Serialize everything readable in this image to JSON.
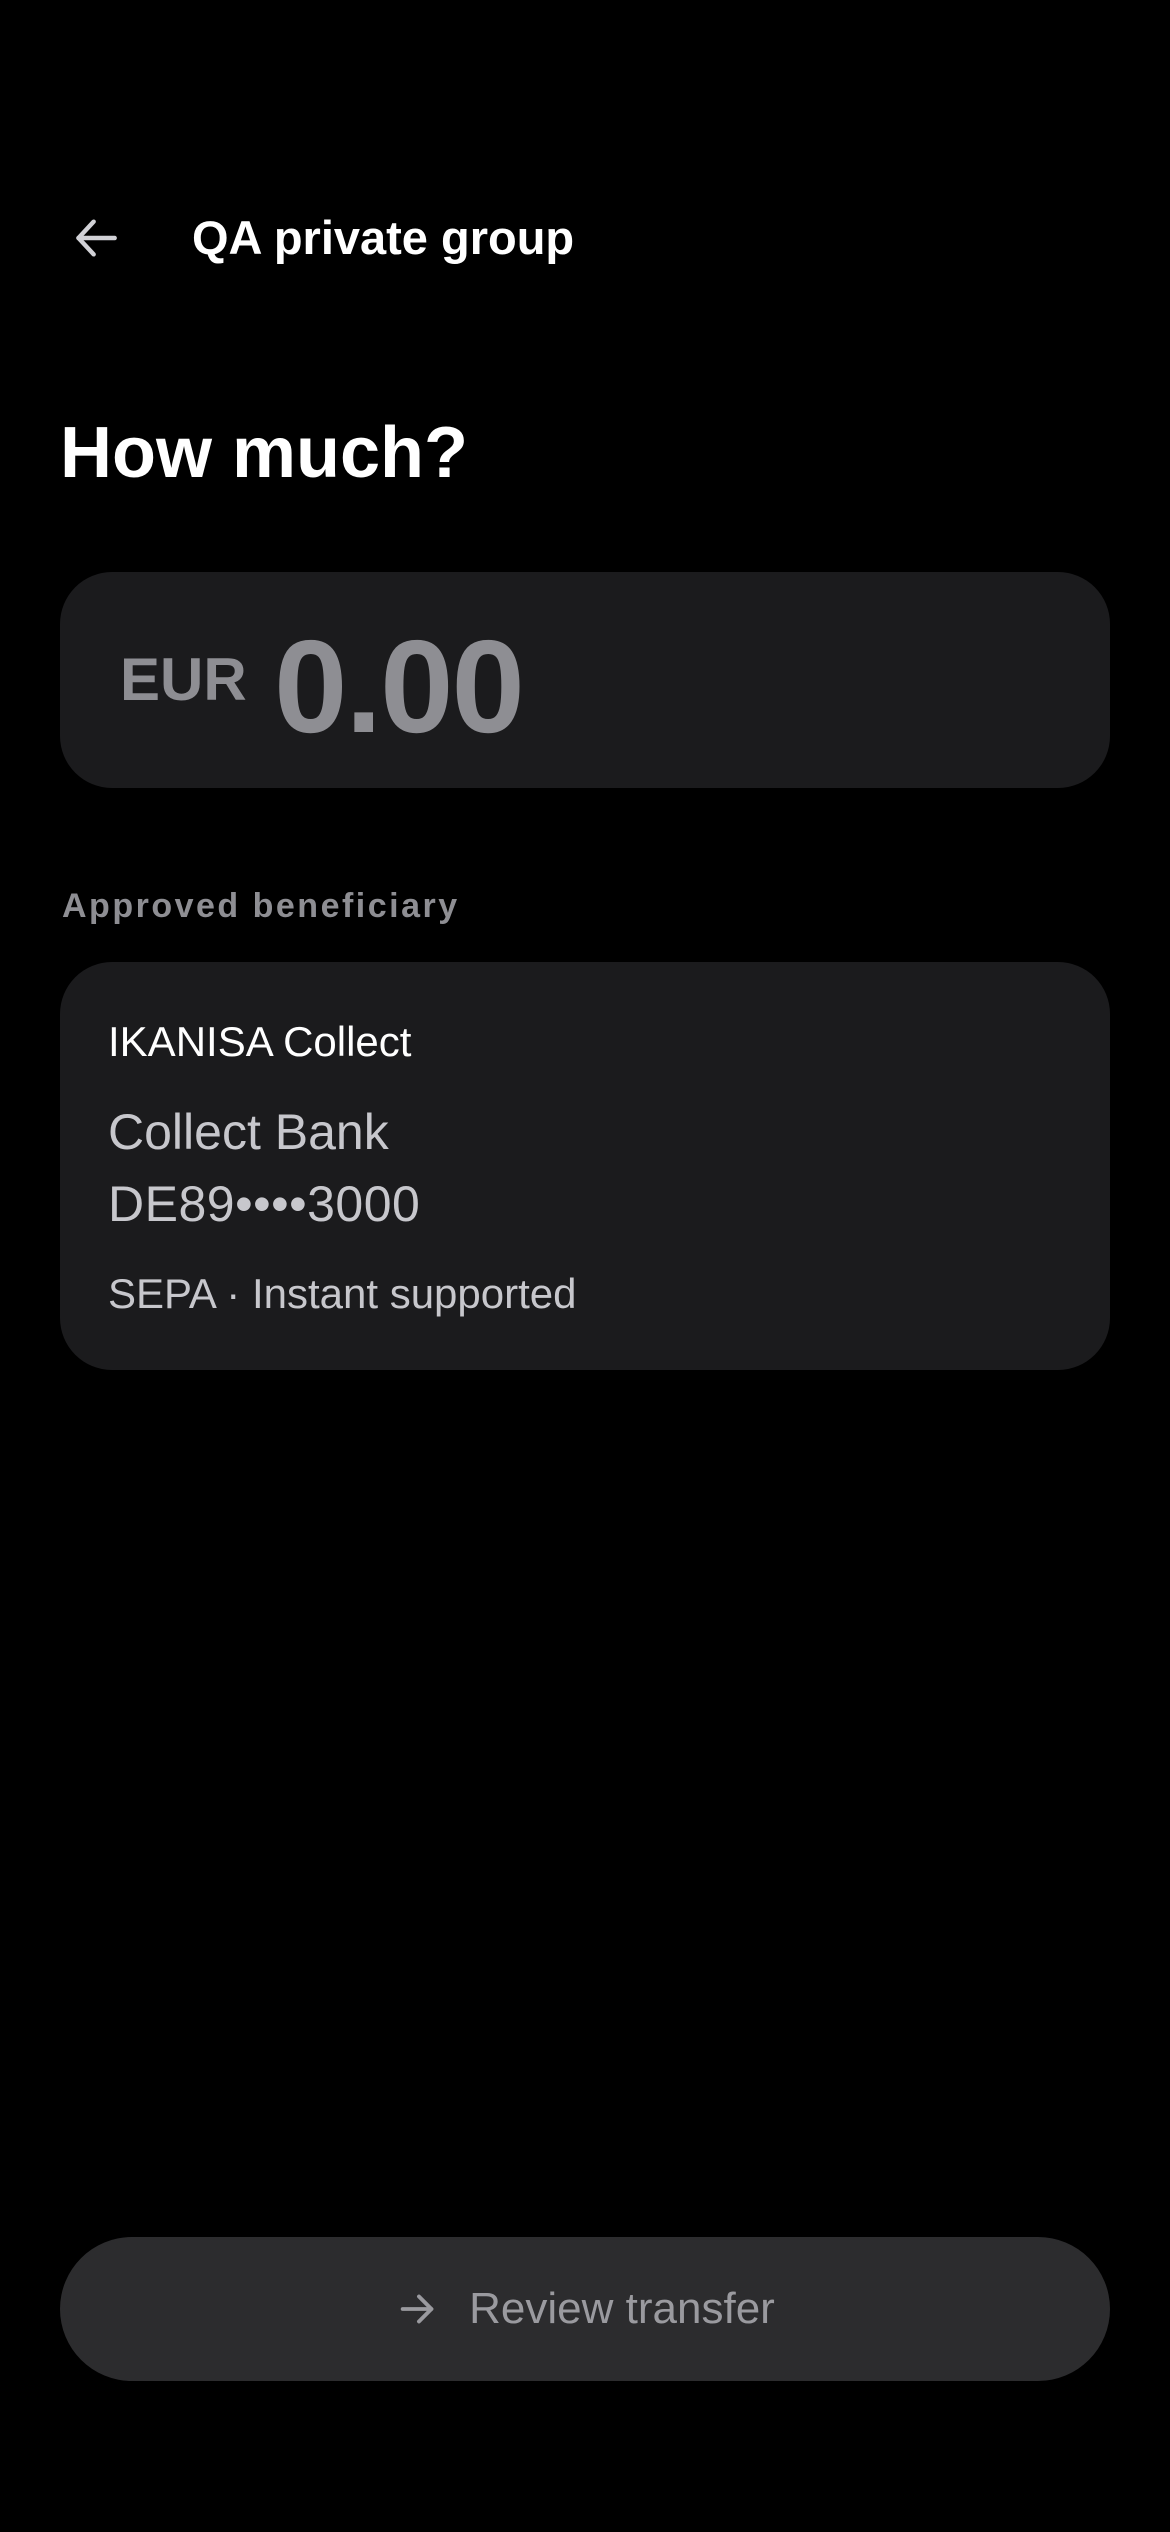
{
  "header": {
    "back_icon": "arrow-left-icon",
    "title": "QA private group"
  },
  "main": {
    "heading": "How much?",
    "amount": {
      "currency": "EUR",
      "value": "0.00"
    },
    "beneficiary_section": {
      "label": "Approved beneficiary",
      "name": "IKANISA Collect",
      "bank": "Collect Bank",
      "iban": "DE89••••3000",
      "meta": "SEPA · Instant supported"
    }
  },
  "footer": {
    "review_button_label": "Review transfer",
    "review_button_icon": "arrow-right-icon"
  },
  "colors": {
    "background": "#000000",
    "card": "#1b1b1d",
    "button": "#2c2c2e",
    "muted_text": "#8e8e93",
    "secondary_text": "#c7c7cc",
    "primary_text": "#ffffff"
  }
}
